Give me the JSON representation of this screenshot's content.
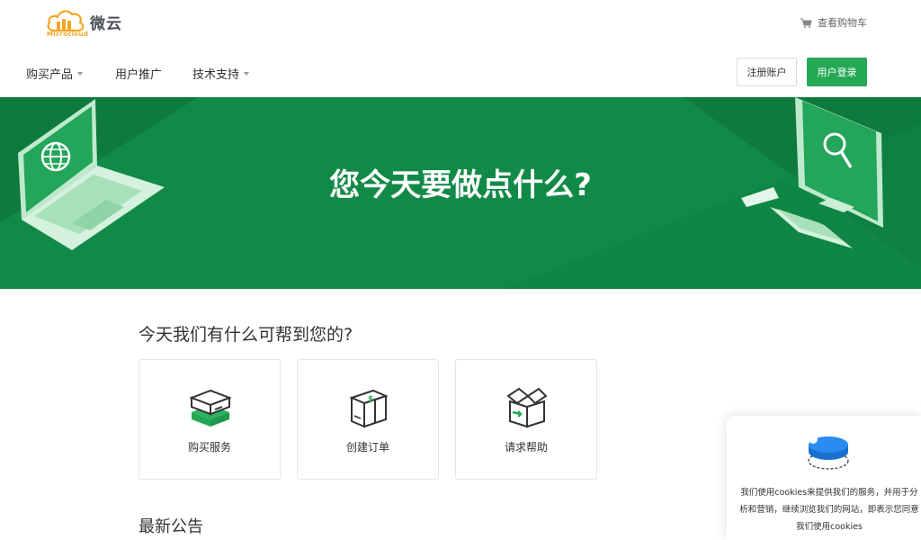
{
  "header": {
    "brand_name": "微云",
    "brand_sub": "Microcloud",
    "cart_label": "查看购物车"
  },
  "nav": {
    "items": [
      {
        "label": "购买产品",
        "has_caret": true
      },
      {
        "label": "用户推广",
        "has_caret": false
      },
      {
        "label": "技术支持",
        "has_caret": true
      }
    ],
    "register_label": "注册账户",
    "login_label": "用户登录"
  },
  "hero": {
    "title": "您今天要做点什么?"
  },
  "help": {
    "title": "今天我们有什么可帮到您的?",
    "cards": [
      {
        "label": "购买服务",
        "icon": "server-stack-icon"
      },
      {
        "label": "创建订单",
        "icon": "package-box-icon"
      },
      {
        "label": "请求帮助",
        "icon": "open-box-icon"
      }
    ]
  },
  "notice": {
    "title": "最新公告"
  },
  "cookie": {
    "text": "我们使用cookies来提供我们的服务，并用于分析和营销，继续浏览我们的网站，即表示您同意我们使用cookies"
  },
  "colors": {
    "brand_green": "#24a854",
    "hero_green": "#128a47",
    "logo_orange": "#f5a623",
    "cookie_blue": "#1e7be0"
  }
}
